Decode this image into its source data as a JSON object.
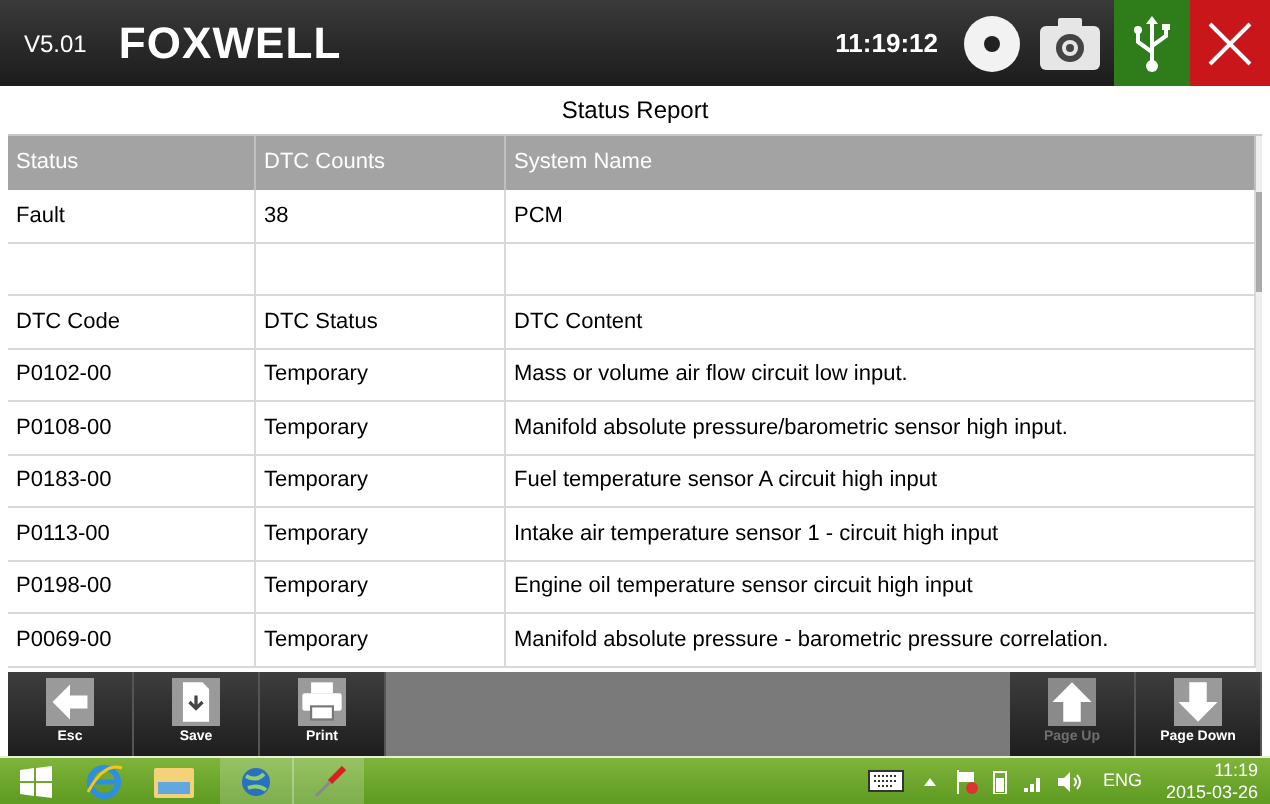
{
  "header": {
    "version": "V5.01",
    "brand": "FOXWELL",
    "time": "11:19:12"
  },
  "title": "Status Report",
  "table": {
    "columns": [
      "Status",
      "DTC Counts",
      "System Name"
    ],
    "rows": [
      {
        "kind": "data",
        "cells": [
          "Fault",
          "38",
          "PCM"
        ]
      },
      {
        "kind": "blank"
      },
      {
        "kind": "data",
        "cells": [
          "DTC Code",
          "DTC Status",
          "DTC Content"
        ]
      },
      {
        "kind": "data",
        "cells": [
          "P0102-00",
          "Temporary",
          "Mass or volume air flow circuit low input."
        ]
      },
      {
        "kind": "data",
        "cells": [
          "P0108-00",
          "Temporary",
          "Manifold absolute pressure/barometric sensor high input."
        ]
      },
      {
        "kind": "data",
        "cells": [
          "P0183-00",
          "Temporary",
          "Fuel temperature sensor A circuit high input"
        ]
      },
      {
        "kind": "data",
        "cells": [
          "P0113-00",
          "Temporary",
          "Intake air temperature sensor 1 - circuit high input"
        ]
      },
      {
        "kind": "data",
        "cells": [
          "P0198-00",
          "Temporary",
          "Engine oil temperature sensor circuit high input"
        ]
      },
      {
        "kind": "data",
        "cells": [
          "P0069-00",
          "Temporary",
          "Manifold absolute pressure - barometric pressure correlation."
        ]
      }
    ]
  },
  "toolbar": {
    "left": [
      {
        "kind": "esc",
        "label": "Esc",
        "disabled": false
      },
      {
        "kind": "save",
        "label": "Save",
        "disabled": false
      },
      {
        "kind": "print",
        "label": "Print",
        "disabled": false
      }
    ],
    "right": [
      {
        "kind": "up",
        "label": "Page Up",
        "disabled": true
      },
      {
        "kind": "down",
        "label": "Page Down",
        "disabled": false
      }
    ]
  },
  "taskbar": {
    "language": "ENG",
    "clock_time": "11:19",
    "clock_date": "2015-03-26"
  }
}
